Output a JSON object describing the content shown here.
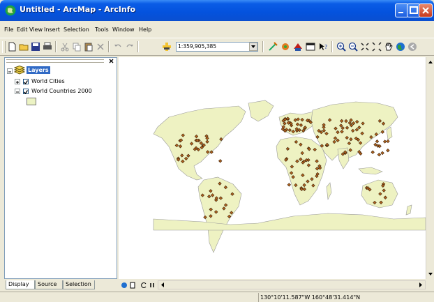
{
  "window": {
    "title": "Untitled - ArcMap - ArcInfo"
  },
  "menu": [
    "File",
    "Edit",
    "View",
    "Insert",
    "Selection",
    "Tools",
    "Window",
    "Help"
  ],
  "toolbar": {
    "scale": "1:359,905,385"
  },
  "toc": {
    "root_label": "Layers",
    "layers": [
      {
        "label": "World Cities",
        "checked": true,
        "expanded": false
      },
      {
        "label": "World Countries 2000",
        "checked": true,
        "expanded": true,
        "swatch_color": "#ecf3c4"
      }
    ]
  },
  "tabs": [
    "Display",
    "Source",
    "Selection"
  ],
  "status": {
    "coordinates": "130°10'11.587\"W  160°48'31.414\"N"
  },
  "colors": {
    "land": "#eef2c2",
    "city": "#b0631e",
    "title_blue": "#0452dd"
  }
}
